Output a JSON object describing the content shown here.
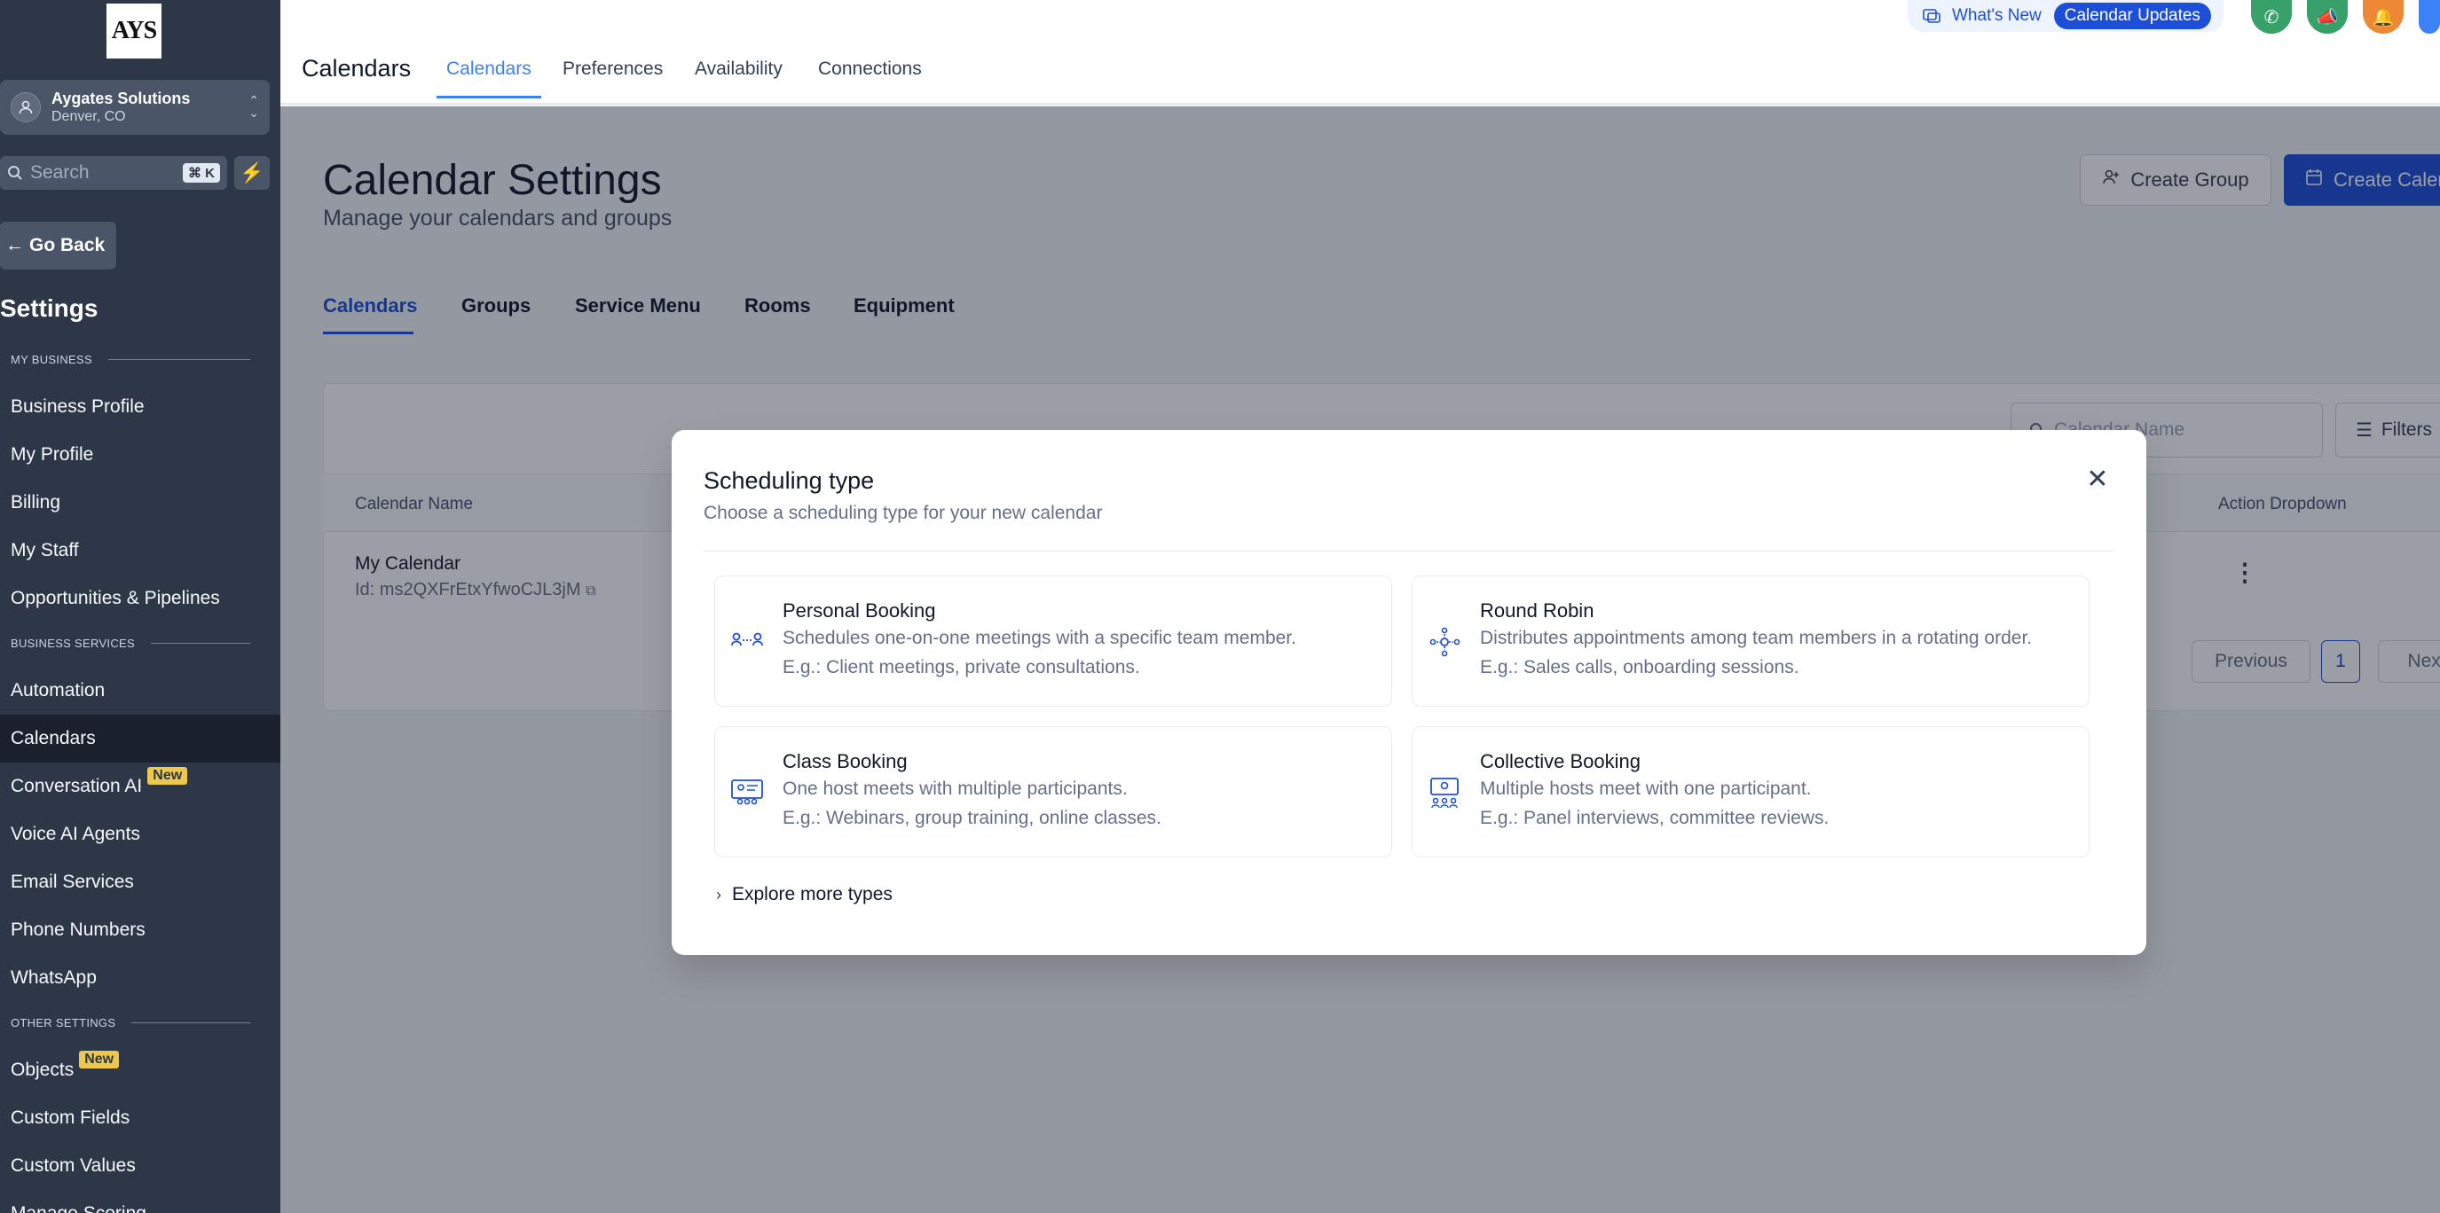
{
  "sidebar": {
    "logo_text": "AYS",
    "account": {
      "name": "Aygates Solutions",
      "location": "Denver, CO"
    },
    "search": {
      "placeholder": "Search",
      "shortcut": "⌘ K"
    },
    "go_back": "Go Back",
    "title": "Settings",
    "sections": {
      "my_business": "MY BUSINESS",
      "business_services": "BUSINESS SERVICES",
      "other_settings": "OTHER SETTINGS"
    },
    "items": {
      "business_profile": "Business Profile",
      "my_profile": "My Profile",
      "billing": "Billing",
      "my_staff": "My Staff",
      "opportunities": "Opportunities & Pipelines",
      "automation": "Automation",
      "calendars": "Calendars",
      "conversation_ai": "Conversation AI",
      "voice_ai": "Voice AI Agents",
      "email_services": "Email Services",
      "phone_numbers": "Phone Numbers",
      "whatsapp": "WhatsApp",
      "objects": "Objects",
      "custom_fields": "Custom Fields",
      "custom_values": "Custom Values",
      "manage_scoring": "Manage Scoring"
    },
    "badge_new": "New"
  },
  "topbar": {
    "app_title": "Calendars",
    "nav": {
      "calendars": "Calendars",
      "preferences": "Preferences",
      "availability": "Availability",
      "connections": "Connections"
    },
    "whats_new": "What's New",
    "calendar_updates": "Calendar Updates"
  },
  "page": {
    "title": "Calendar Settings",
    "subtitle": "Manage your calendars and groups",
    "create_group": "Create Group",
    "create_calendar": "Create Calendar",
    "tabs": {
      "calendars": "Calendars",
      "groups": "Groups",
      "service_menu": "Service Menu",
      "rooms": "Rooms",
      "equipment": "Equipment"
    },
    "search_placeholder": "Calendar Name",
    "filters": "Filters",
    "columns": {
      "name": "Calendar Name",
      "action": "Action Dropdown"
    },
    "row": {
      "name": "My Calendar",
      "id": "Id: ms2QXFrEtxYfwoCJL3jM"
    },
    "pagination": {
      "previous": "Previous",
      "page": "1",
      "next": "Next"
    }
  },
  "modal": {
    "title": "Scheduling type",
    "subtitle": "Choose a scheduling type for your new calendar",
    "options": {
      "personal": {
        "title": "Personal Booking",
        "desc": "Schedules one-on-one meetings with a specific team member.",
        "eg": "E.g.: Client meetings, private consultations."
      },
      "round_robin": {
        "title": "Round Robin",
        "desc": "Distributes appointments among team members in a rotating order.",
        "eg": "E.g.: Sales calls, onboarding sessions."
      },
      "class": {
        "title": "Class Booking",
        "desc": "One host meets with multiple participants.",
        "eg": "E.g.: Webinars, group training, online classes."
      },
      "collective": {
        "title": "Collective Booking",
        "desc": "Multiple hosts meet with one participant.",
        "eg": "E.g.: Panel interviews, committee reviews."
      }
    },
    "explore": "Explore more types"
  },
  "colors": {
    "sidebar_bg": "#2d3748",
    "accent": "#1d4ed8",
    "link_blue": "#3b82f6",
    "badge_yellow": "#ecc94b"
  }
}
